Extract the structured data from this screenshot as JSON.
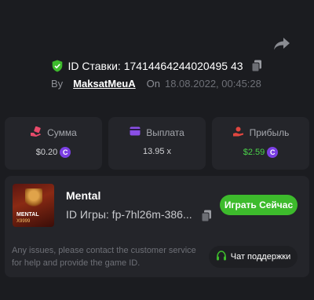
{
  "header": {
    "bet_id": "ID Ставки: 17414464244020495 43",
    "by_label": "By",
    "username": "MaksatMeuA",
    "on_label": "On",
    "datetime": "18.08.2022, 00:45:28"
  },
  "stats": [
    {
      "label": "Сумма",
      "value": "$0.20",
      "icon": "amount-icon"
    },
    {
      "label": "Выплата",
      "value": "13.95 x",
      "icon": "wallet-icon"
    },
    {
      "label": "Прибыль",
      "value": "$2.59",
      "icon": "profit-icon"
    }
  ],
  "game": {
    "name": "Mental",
    "id_text": "ID Игры: fp-7hl26m-386...",
    "thumb_title": "MENTAL",
    "thumb_sub": "X9999",
    "play_label": "Играть Сейчас",
    "issues_text": "Any issues, please contact the customer service for help and provide the game ID.",
    "support_label": "Чат поддержки"
  },
  "colors": {
    "accent_green": "#3dbb2c",
    "profit_green": "#4bd34a",
    "coin_purple": "#7b3fe4",
    "icon_pink": "#e84a6a",
    "icon_purple": "#8a4fe6",
    "icon_red": "#e0463f"
  }
}
